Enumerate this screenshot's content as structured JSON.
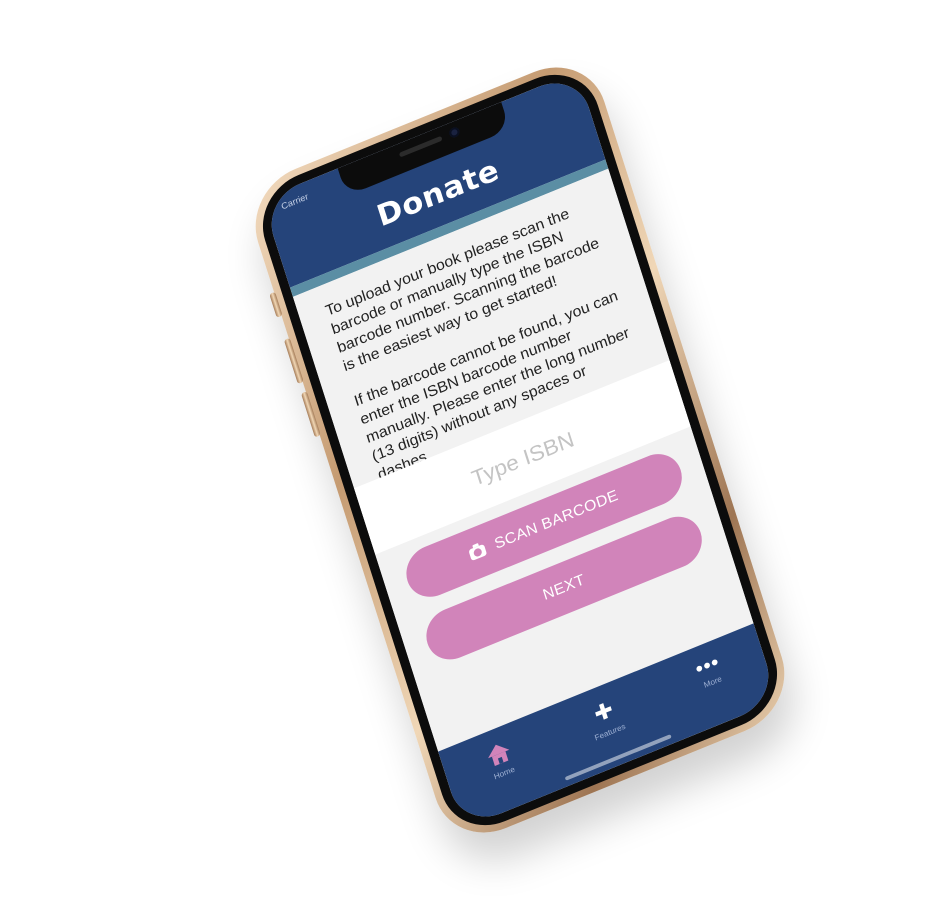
{
  "status_bar": {
    "carrier": "Carrier"
  },
  "header": {
    "title": "Donate"
  },
  "intro": {
    "paragraph1": "To upload your book please scan the barcode or manually type the ISBN barcode number. Scanning the barcode is the easiest way to get started!",
    "paragraph2": "If the barcode cannot be found, you can enter the ISBN barcode number manually. Please enter the long number (13 digits) without any spaces or dashes."
  },
  "isbn_input": {
    "placeholder": "Type ISBN",
    "value": ""
  },
  "buttons": {
    "scan_label": "SCAN BARCODE",
    "next_label": "NEXT"
  },
  "tab_bar": {
    "items": [
      {
        "label": "Home",
        "icon": "home-icon"
      },
      {
        "label": "Features",
        "icon": "puzzle-icon"
      },
      {
        "label": "More",
        "icon": "more-dots-icon"
      }
    ]
  },
  "colors": {
    "header": "#25447a",
    "stripe": "#5b8ea4",
    "button": "#d184ba",
    "background": "#f2f2f2",
    "phone_gold": "#c59b72"
  }
}
